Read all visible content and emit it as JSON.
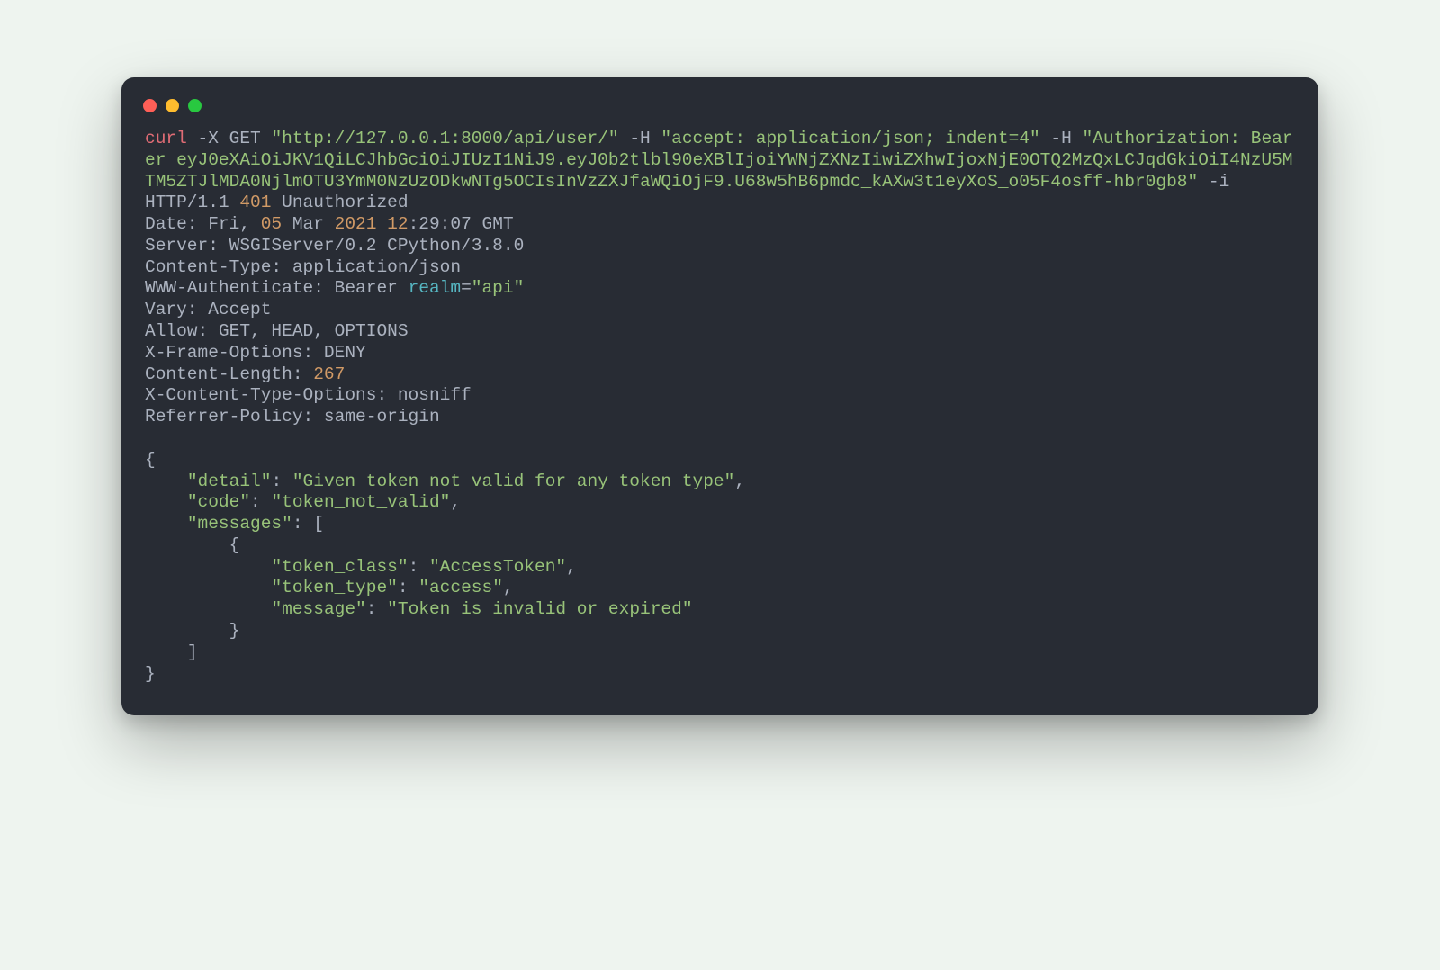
{
  "cmd": {
    "curl": "curl",
    "xflag": "-X",
    "method": "GET",
    "url": "\"http://127.0.0.1:8000/api/user/\"",
    "hflag1": "-H",
    "hval1a": "\"accept: application/json; indent=4\"",
    "hflag2": "-H",
    "hval2": "\"Authorization: Bearer eyJ0eXAiOiJKV1QiLCJhbGciOiJIUzI1NiJ9.eyJ0b2tlbl90eXBlIjoiYWNjZXNzIiwiZXhwIjoxNjE0OTQ2MzQxLCJqdGkiOiI4NzU5MTM5ZTJlMDA0NjlmOTU3YmM0NzUzODkwNTg5OCIsInVzZXJfaWQiOjF9.U68w5hB6pmdc_kAXw3t1eyXoS_o05F4osff-hbr0gb8\"",
    "iflag": "-i"
  },
  "resp": {
    "status_proto": "HTTP/1.1 ",
    "status_code": "401",
    "status_text": " Unauthorized",
    "date_pre": "Date: Fri, ",
    "date_day": "05",
    "date_mid": " Mar ",
    "date_year": "2021",
    "date_sp": " ",
    "date_hour": "12",
    "date_rest": ":29:07 GMT",
    "server": "Server: WSGIServer/0.2 CPython/3.8.0",
    "ctype": "Content-Type: application/json",
    "www_pre": "WWW-Authenticate: Bearer ",
    "www_realm": "realm",
    "www_eq": "=",
    "www_val": "\"api\"",
    "vary": "Vary: Accept",
    "allow": "Allow: GET, HEAD, OPTIONS",
    "xframe": "X-Frame-Options: DENY",
    "clen_pre": "Content-Length: ",
    "clen_val": "267",
    "xcto": "X-Content-Type-Options: nosniff",
    "refpol": "Referrer-Policy: same-origin"
  },
  "body": {
    "l1": "{",
    "l2a": "    ",
    "l2b": "\"detail\"",
    "l2c": ": ",
    "l2d": "\"Given token not valid for any token type\"",
    "l2e": ",",
    "l3a": "    ",
    "l3b": "\"code\"",
    "l3c": ": ",
    "l3d": "\"token_not_valid\"",
    "l3e": ",",
    "l4a": "    ",
    "l4b": "\"messages\"",
    "l4c": ": [",
    "l5": "        {",
    "l6a": "            ",
    "l6b": "\"token_class\"",
    "l6c": ": ",
    "l6d": "\"AccessToken\"",
    "l6e": ",",
    "l7a": "            ",
    "l7b": "\"token_type\"",
    "l7c": ": ",
    "l7d": "\"access\"",
    "l7e": ",",
    "l8a": "            ",
    "l8b": "\"message\"",
    "l8c": ": ",
    "l8d": "\"Token is invalid or expired\"",
    "l9": "        }",
    "l10": "    ]",
    "l11": "}"
  }
}
